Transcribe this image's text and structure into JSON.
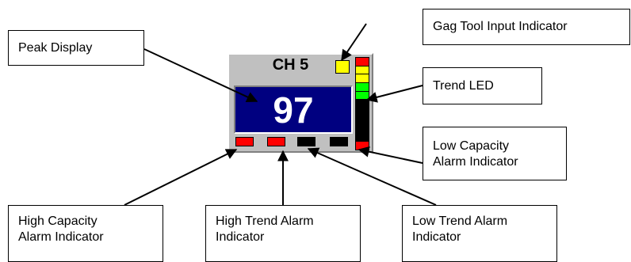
{
  "widget": {
    "channel_label": "CH 5",
    "peak_value": "97",
    "gag_indicator_color": "#ffff00",
    "trend_led_segments": [
      "#ff0000",
      "#ffff00",
      "#ffff00",
      "#00ff00",
      "#00ff00",
      "#000000",
      "#000000",
      "#000000",
      "#000000",
      "#000000",
      "#ff0000"
    ],
    "alarms": {
      "high_capacity": "#ff0000",
      "high_trend": "#ff0000",
      "low_trend": "#000000",
      "low_capacity": "#000000"
    },
    "display_background": "#000080"
  },
  "callouts": {
    "peak_display": [
      "Peak Display"
    ],
    "gag_tool": [
      "Gag Tool Input Indicator"
    ],
    "trend_led": [
      "Trend LED"
    ],
    "low_capacity": [
      "Low Capacity",
      "Alarm Indicator"
    ],
    "high_capacity": [
      "High Capacity",
      "Alarm Indicator"
    ],
    "high_trend": [
      "High Trend Alarm",
      "Indicator"
    ],
    "low_trend": [
      "Low Trend Alarm",
      "Indicator"
    ]
  }
}
